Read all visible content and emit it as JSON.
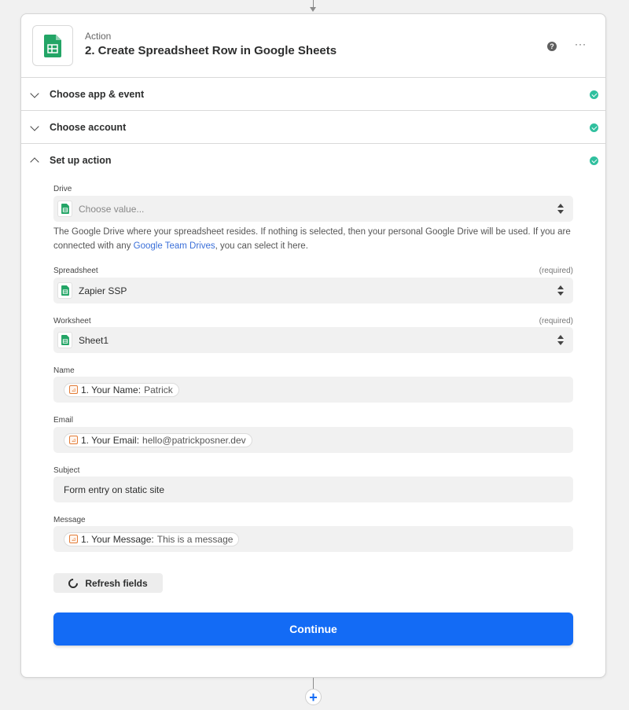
{
  "header": {
    "label": "Action",
    "title": "2. Create Spreadsheet Row in Google Sheets",
    "help_glyph": "?",
    "more_glyph": "···",
    "app_icon": "google-sheets-icon"
  },
  "sections": [
    {
      "label": "Choose app & event",
      "state": "collapsed",
      "complete": true
    },
    {
      "label": "Choose account",
      "state": "collapsed",
      "complete": true
    },
    {
      "label": "Set up action",
      "state": "expanded",
      "complete": true
    }
  ],
  "fields": {
    "drive": {
      "label": "Drive",
      "placeholder": "Choose value...",
      "help_before": "The Google Drive where your spreadsheet resides. If nothing is selected, then your personal Google Drive will be used. If you are connected with any ",
      "help_link": "Google Team Drives",
      "help_after": ", you can select it here."
    },
    "spreadsheet": {
      "label": "Spreadsheet",
      "required": "(required)",
      "value": "Zapier SSP"
    },
    "worksheet": {
      "label": "Worksheet",
      "required": "(required)",
      "value": "Sheet1"
    },
    "name": {
      "label": "Name",
      "pill_key": "1. Your Name:",
      "pill_value": "Patrick"
    },
    "email": {
      "label": "Email",
      "pill_key": "1. Your Email:",
      "pill_value": "hello@patrickposner.dev"
    },
    "subject": {
      "label": "Subject",
      "value": "Form entry on static site"
    },
    "message": {
      "label": "Message",
      "pill_key": "1. Your Message:",
      "pill_value": "This is a message"
    }
  },
  "buttons": {
    "refresh": "Refresh fields",
    "continue": "Continue",
    "add_step_glyph": "+"
  },
  "colors": {
    "primary": "#136bf5",
    "success": "#2fbf9e",
    "sheets_green": "#23a566",
    "link": "#3a6fd9"
  }
}
